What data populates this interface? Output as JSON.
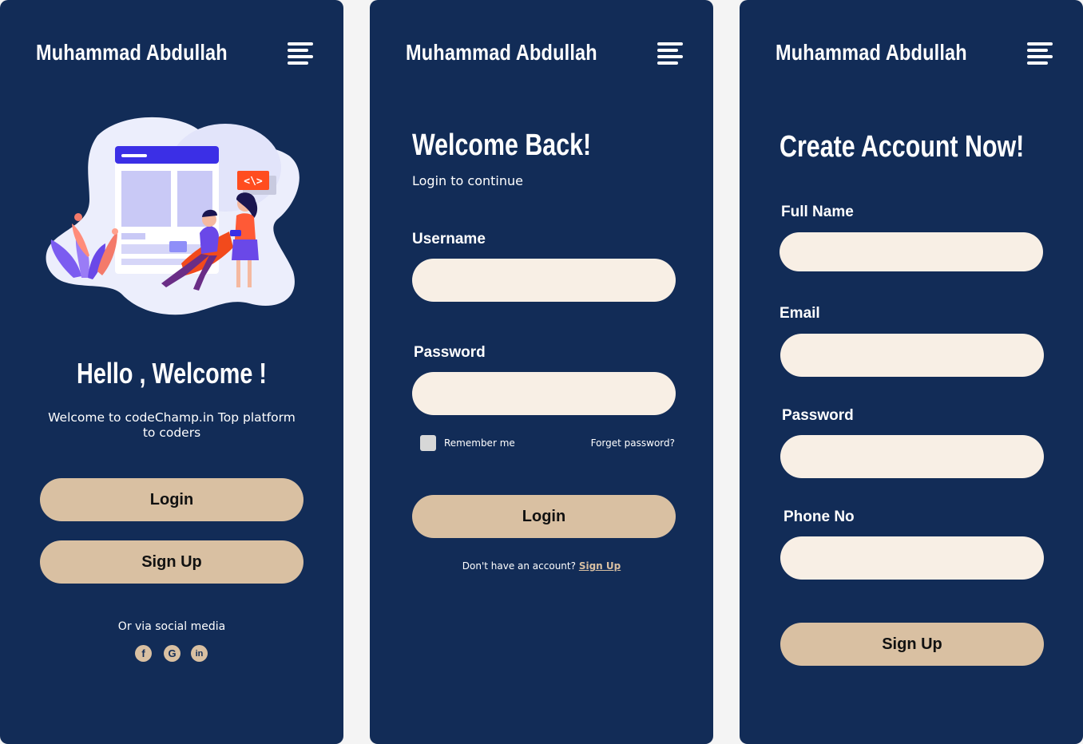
{
  "brand": "Muhammad Abdullah",
  "colors": {
    "background": "#122c57",
    "button": "#d9c0a2",
    "input": "#f8efe5",
    "page": "#f4f4f4"
  },
  "welcome_screen": {
    "title": "Hello , Welcome !",
    "subtitle": "Welcome to codeChamp.in Top platform to coders",
    "login_label": "Login",
    "signup_label": "Sign Up",
    "social_text": "Or  via social media",
    "illustration_code_tag": "<\\>",
    "social_icons": [
      "facebook-icon",
      "google-icon",
      "linkedin-icon"
    ],
    "social_glyphs": {
      "facebook": "f",
      "google": "G",
      "linkedin": "in"
    }
  },
  "login_screen": {
    "title": "Welcome Back!",
    "subtitle": "Login to continue",
    "username_label": "Username",
    "username_value": "",
    "password_label": "Password",
    "password_value": "",
    "remember_label": "Remember me",
    "remember_checked": false,
    "forgot_label": "Forget password?",
    "login_label": "Login",
    "no_account_text": "Don't have an account?",
    "signup_link": "Sign Up"
  },
  "signup_screen": {
    "title": "Create Account Now!",
    "fullname_label": "Full Name",
    "fullname_value": "",
    "email_label": "Email",
    "email_value": "",
    "password_label": "Password",
    "password_value": "",
    "phone_label": "Phone No",
    "phone_value": "",
    "signup_label": "Sign Up"
  }
}
